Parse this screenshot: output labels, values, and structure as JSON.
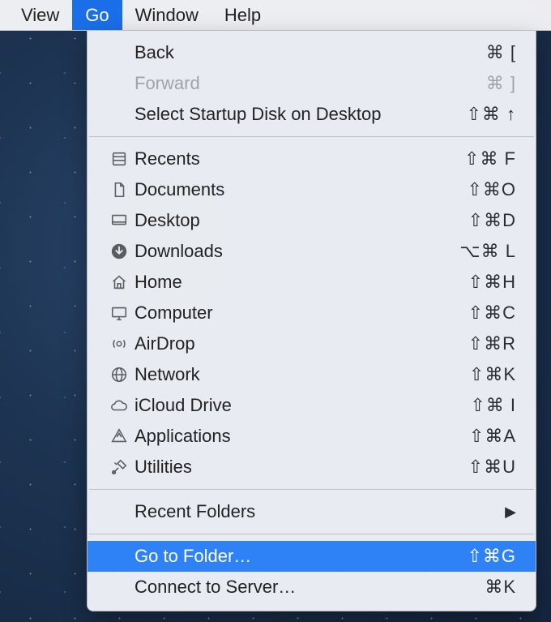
{
  "menubar": {
    "view": "View",
    "go": "Go",
    "window": "Window",
    "help": "Help"
  },
  "menu": {
    "back": {
      "label": "Back",
      "shortcut": "⌘ ["
    },
    "forward": {
      "label": "Forward",
      "shortcut": "⌘ ]"
    },
    "startup_disk": {
      "label": "Select Startup Disk on Desktop",
      "shortcut": "⇧⌘ ↑"
    },
    "recents": {
      "label": "Recents",
      "shortcut": "⇧⌘ F"
    },
    "documents": {
      "label": "Documents",
      "shortcut": "⇧⌘O"
    },
    "desktop": {
      "label": "Desktop",
      "shortcut": "⇧⌘D"
    },
    "downloads": {
      "label": "Downloads",
      "shortcut": "⌥⌘ L"
    },
    "home": {
      "label": "Home",
      "shortcut": "⇧⌘H"
    },
    "computer": {
      "label": "Computer",
      "shortcut": "⇧⌘C"
    },
    "airdrop": {
      "label": "AirDrop",
      "shortcut": "⇧⌘R"
    },
    "network": {
      "label": "Network",
      "shortcut": "⇧⌘K"
    },
    "icloud": {
      "label": "iCloud Drive",
      "shortcut": "⇧⌘ I"
    },
    "applications": {
      "label": "Applications",
      "shortcut": "⇧⌘A"
    },
    "utilities": {
      "label": "Utilities",
      "shortcut": "⇧⌘U"
    },
    "recent_folders": {
      "label": "Recent Folders"
    },
    "go_to_folder": {
      "label": "Go to Folder…",
      "shortcut": "⇧⌘G"
    },
    "connect_server": {
      "label": "Connect to Server…",
      "shortcut": "⌘K"
    }
  }
}
